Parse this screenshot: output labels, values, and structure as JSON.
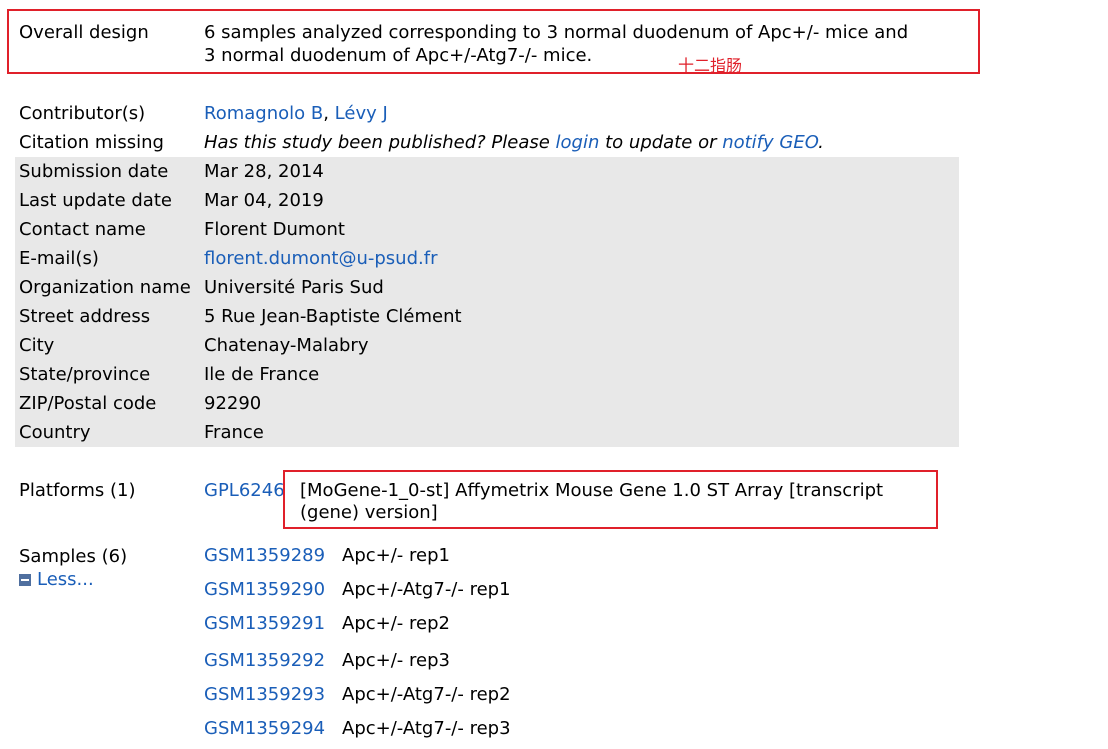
{
  "overall_design": {
    "label": "Overall design",
    "line1": "6 samples analyzed corresponding to 3 normal duodenum of Apc+/- mice and",
    "line2": "3 normal duodenum of Apc+/-Atg7-/- mice.",
    "annotation": "十二指肠"
  },
  "contributors": {
    "label": "Contributor(s)",
    "names": [
      "Romagnolo B",
      "Lévy J"
    ],
    "separator": ", "
  },
  "citation": {
    "label": "Citation missing",
    "text_before": "Has this study been published? Please ",
    "login_link": "login",
    "text_middle": " to update or ",
    "notify_link": "notify GEO",
    "text_after": "."
  },
  "info_rows": [
    {
      "label": "Submission date",
      "value": "Mar 28, 2014",
      "is_link": false
    },
    {
      "label": "Last update date",
      "value": "Mar 04, 2019",
      "is_link": false
    },
    {
      "label": "Contact name",
      "value": "Florent Dumont",
      "is_link": false
    },
    {
      "label": "E-mail(s)",
      "value": "florent.dumont@u-psud.fr",
      "is_link": true
    },
    {
      "label": "Organization name",
      "value": "Université Paris Sud",
      "is_link": false
    },
    {
      "label": "Street address",
      "value": "5 Rue Jean-Baptiste Clément",
      "is_link": false
    },
    {
      "label": "City",
      "value": "Chatenay-Malabry",
      "is_link": false
    },
    {
      "label": "State/province",
      "value": "Ile de France",
      "is_link": false
    },
    {
      "label": "ZIP/Postal code",
      "value": "92290",
      "is_link": false
    },
    {
      "label": "Country",
      "value": "France",
      "is_link": false
    }
  ],
  "platforms": {
    "label": "Platforms (1)",
    "id": "GPL6246",
    "desc_line1": "[MoGene-1_0-st] Affymetrix Mouse Gene 1.0 ST Array [transcript",
    "desc_line2": "(gene) version]"
  },
  "samples": {
    "label": "Samples (6)",
    "less_label": "Less...",
    "items": [
      {
        "id": "GSM1359289",
        "title": "Apc+/- rep1"
      },
      {
        "id": "GSM1359290",
        "title": "Apc+/-Atg7-/- rep1"
      },
      {
        "id": "GSM1359291",
        "title": "Apc+/- rep2"
      },
      {
        "id": "GSM1359292",
        "title": "Apc+/- rep3"
      },
      {
        "id": "GSM1359293",
        "title": "Apc+/-Atg7-/- rep2"
      },
      {
        "id": "GSM1359294",
        "title": "Apc+/-Atg7-/- rep3"
      }
    ]
  },
  "colors": {
    "link": "#1a5eb8",
    "highlight_box": "#e0202a",
    "row_shading": "#e8e8e8"
  }
}
